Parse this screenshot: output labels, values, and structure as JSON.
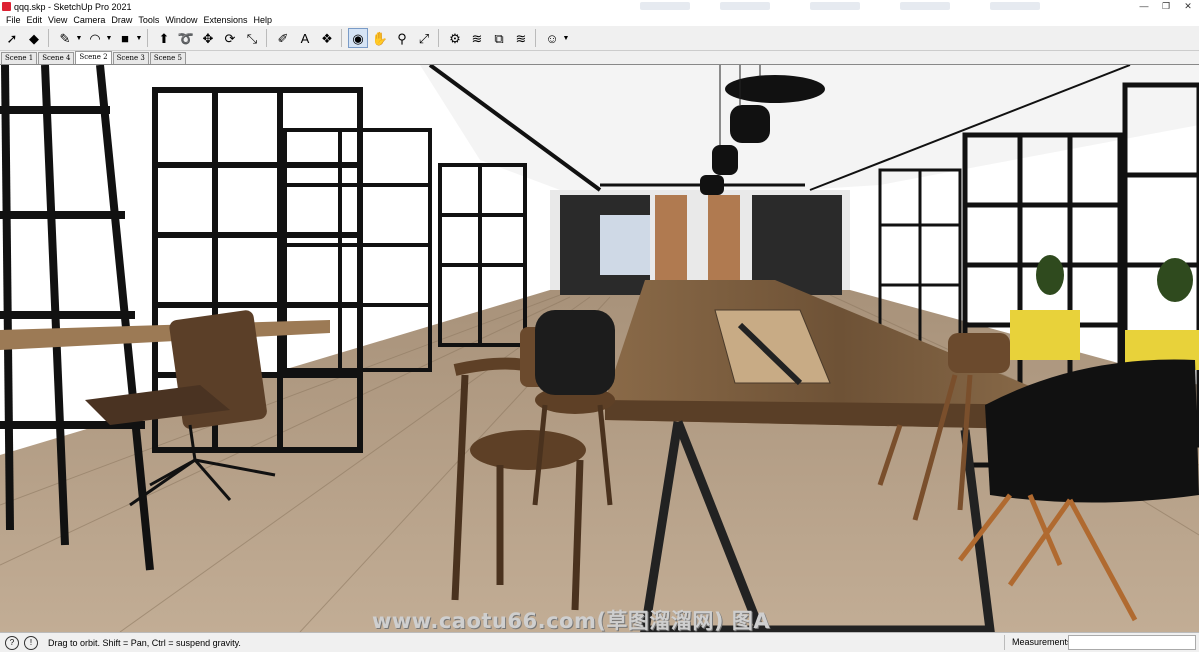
{
  "window": {
    "title": "qqq.skp - SketchUp Pro 2021",
    "controls": [
      "—",
      "❐",
      "✕"
    ]
  },
  "menu": [
    "File",
    "Edit",
    "View",
    "Camera",
    "Draw",
    "Tools",
    "Window",
    "Extensions",
    "Help"
  ],
  "toolbar": {
    "tools": [
      {
        "name": "select-tool",
        "glyph": "➚"
      },
      {
        "name": "eraser-tool",
        "glyph": "◆"
      },
      {
        "name": "line-tool",
        "glyph": "✎",
        "dropdown": true
      },
      {
        "name": "arc-tool",
        "glyph": "◠",
        "dropdown": true
      },
      {
        "name": "rectangle-tool",
        "glyph": "■",
        "dropdown": true
      },
      {
        "name": "push-pull-tool",
        "glyph": "⬆"
      },
      {
        "name": "follow-me-tool",
        "glyph": "➰"
      },
      {
        "name": "move-tool",
        "glyph": "✥"
      },
      {
        "name": "rotate-tool",
        "glyph": "⟳"
      },
      {
        "name": "scale-tool",
        "glyph": "⤡"
      },
      {
        "name": "tape-measure-tool",
        "glyph": "✐"
      },
      {
        "name": "text-tool",
        "glyph": "A"
      },
      {
        "name": "paint-bucket-tool",
        "glyph": "❖"
      },
      {
        "name": "orbit-tool",
        "glyph": "◉",
        "active": true
      },
      {
        "name": "pan-tool",
        "glyph": "✋"
      },
      {
        "name": "zoom-tool",
        "glyph": "⚲"
      },
      {
        "name": "zoom-extents-tool",
        "glyph": "⤢"
      },
      {
        "name": "3d-warehouse-icon",
        "glyph": "⚙"
      },
      {
        "name": "extension-warehouse-icon",
        "glyph": "≋"
      },
      {
        "name": "layout-icon",
        "glyph": "⧉"
      },
      {
        "name": "extension-manager-icon",
        "glyph": "≋"
      },
      {
        "name": "account-icon",
        "glyph": "☺",
        "dropdown": true
      }
    ]
  },
  "scenes": [
    "Scene 1",
    "Scene 4",
    "Scene 2",
    "Scene 3",
    "Scene 5"
  ],
  "active_scene": "Scene 2",
  "watermark": "www.caotu66.com(草图溜溜网) 图A",
  "status": {
    "icons": [
      "?",
      "!"
    ],
    "hint": "Drag to orbit. Shift = Pan, Ctrl = suspend gravity.",
    "measurements_label": "Measurements",
    "measurements_value": ""
  },
  "colors": {
    "floor": "#b09a80",
    "wood": "#7a5a3a",
    "frame": "#1e1e1e",
    "ceiling": "#f4f4f4",
    "accent_yellow": "#e8d23a"
  }
}
